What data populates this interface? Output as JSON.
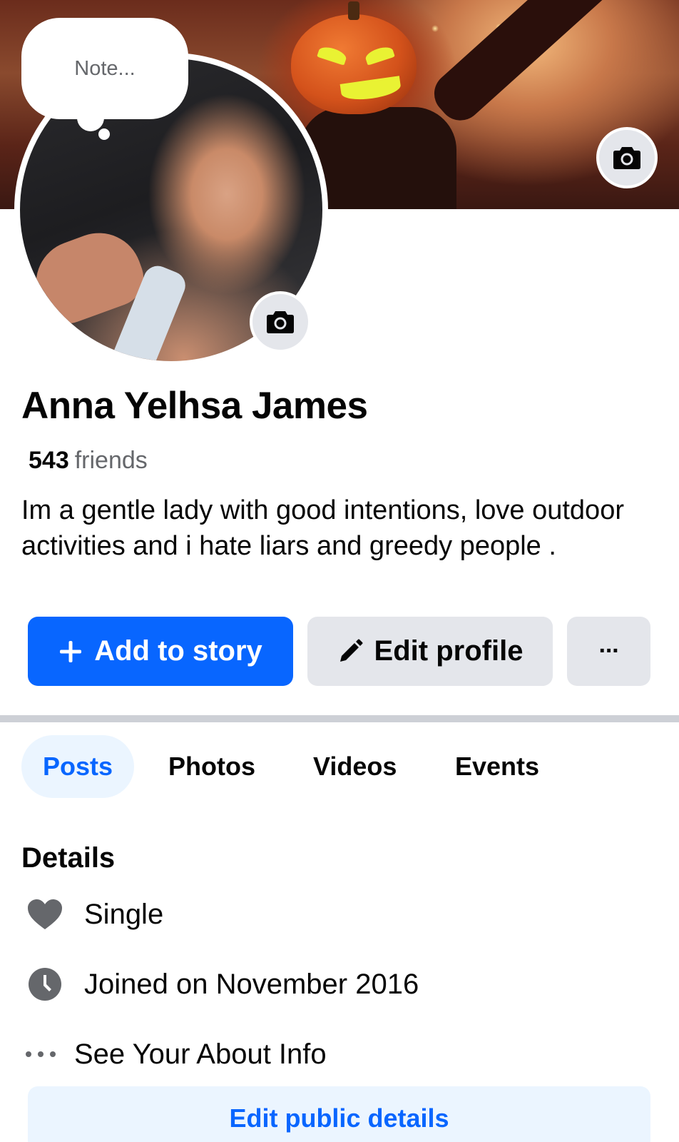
{
  "note": {
    "placeholder": "Note..."
  },
  "profile": {
    "name": "Anna Yelhsa James",
    "friends_count": "543",
    "friends_label": "friends",
    "bio": "Im a gentle lady with good intentions, love outdoor activities and i hate liars and greedy people ."
  },
  "actions": {
    "add_story": "Add to story",
    "edit_profile": "Edit profile",
    "more": "···"
  },
  "tabs": [
    {
      "label": "Posts",
      "active": true
    },
    {
      "label": "Photos",
      "active": false
    },
    {
      "label": "Videos",
      "active": false
    },
    {
      "label": "Events",
      "active": false
    }
  ],
  "details": {
    "title": "Details",
    "items": [
      {
        "icon": "heart-icon",
        "text": "Single"
      },
      {
        "icon": "clock-icon",
        "text": "Joined on November 2016"
      },
      {
        "icon": "more-dots-icon",
        "text": "See Your About Info"
      }
    ],
    "edit_button": "Edit public details"
  },
  "colors": {
    "accent": "#0866ff",
    "accent_light": "#ebf5ff",
    "button_gray": "#e4e6eb",
    "secondary_text": "#65676b"
  }
}
